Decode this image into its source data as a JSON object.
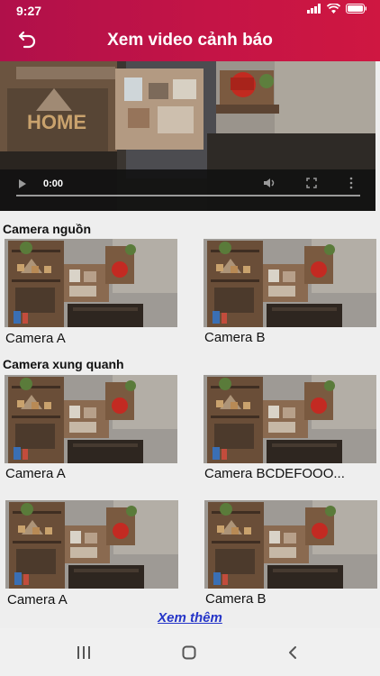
{
  "status_bar": {
    "time": "9:27"
  },
  "header": {
    "title": "Xem video cảnh báo"
  },
  "player": {
    "current_time": "0:00",
    "progress": 0
  },
  "sections": [
    {
      "title": "Camera nguồn",
      "cameras": [
        "Camera A",
        "Camera B"
      ]
    },
    {
      "title": "Camera xung quanh",
      "cameras": [
        "Camera A",
        "Camera BCDEFOOO...",
        "Camera A",
        "Camera B"
      ]
    }
  ],
  "more_link": "Xem thêm",
  "colors": {
    "header_gradient_start": "#b0104a",
    "header_gradient_end": "#cf1741",
    "link": "#2535c8"
  }
}
